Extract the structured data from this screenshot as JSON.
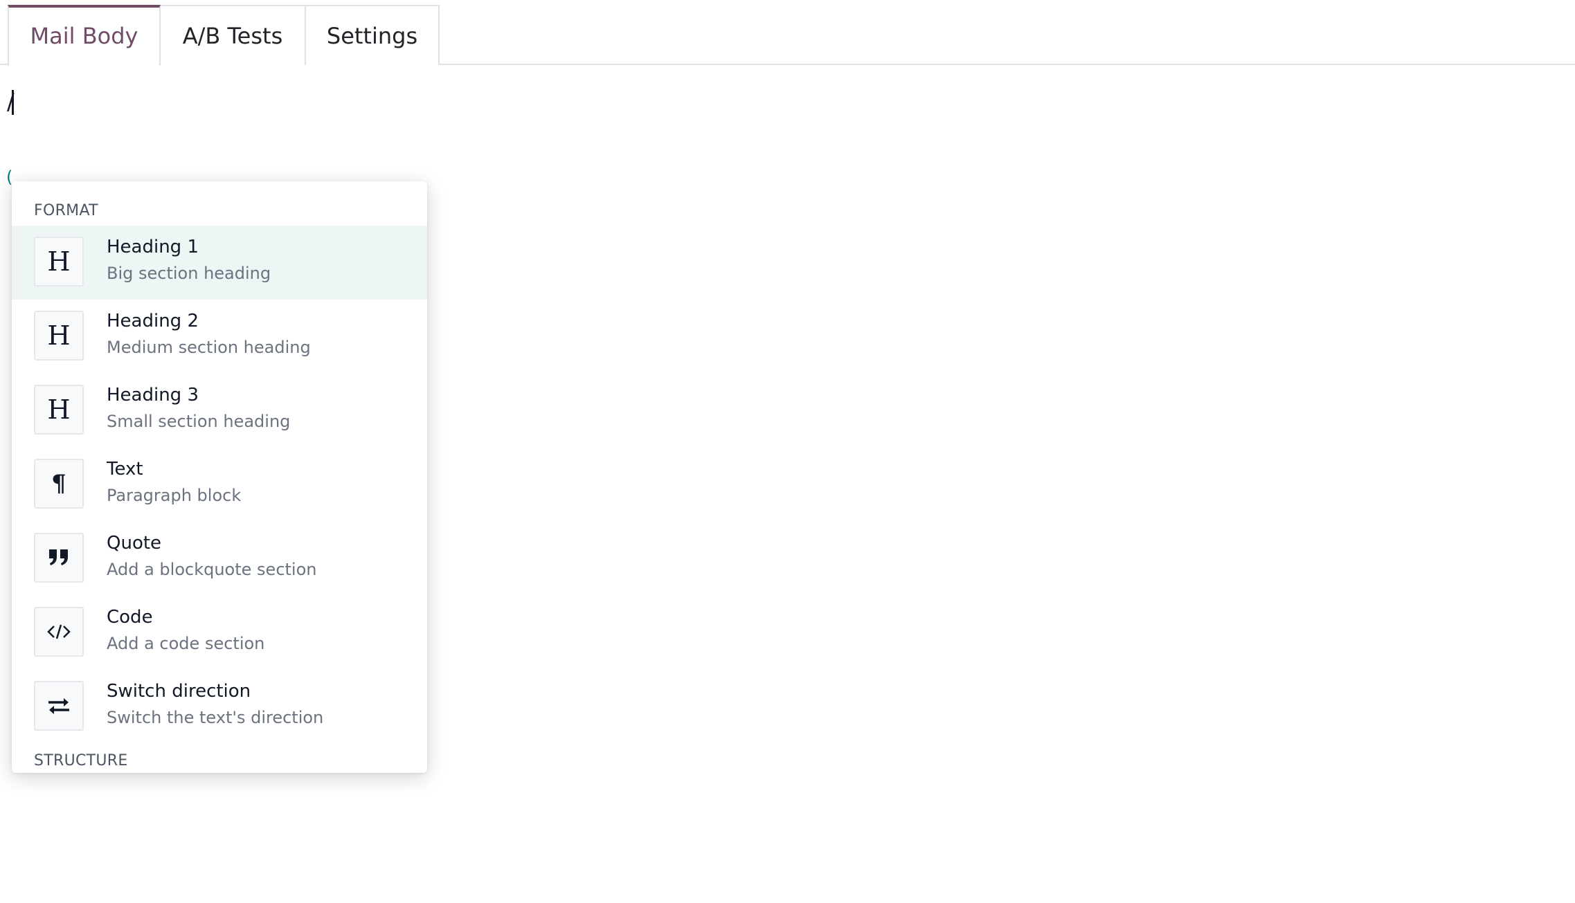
{
  "tabs": [
    {
      "label": "Mail Body",
      "active": true
    },
    {
      "label": "A/B Tests",
      "active": false
    },
    {
      "label": "Settings",
      "active": false
    }
  ],
  "editor": {
    "typed_text": "/"
  },
  "powerbox": {
    "groups": {
      "format": "FORMAT",
      "structure": "STRUCTURE"
    },
    "items": [
      {
        "title": "Heading 1",
        "description": "Big section heading",
        "icon": "heading-icon",
        "glyph": "H",
        "active": true
      },
      {
        "title": "Heading 2",
        "description": "Medium section heading",
        "icon": "heading-icon",
        "glyph": "H",
        "active": false
      },
      {
        "title": "Heading 3",
        "description": "Small section heading",
        "icon": "heading-icon",
        "glyph": "H",
        "active": false
      },
      {
        "title": "Text",
        "description": "Paragraph block",
        "icon": "paragraph-icon",
        "glyph": "¶",
        "active": false
      },
      {
        "title": "Quote",
        "description": "Add a blockquote section",
        "icon": "quote-icon",
        "active": false
      },
      {
        "title": "Code",
        "description": "Add a code section",
        "icon": "code-icon",
        "active": false
      },
      {
        "title": "Switch direction",
        "description": "Switch the text's direction",
        "icon": "exchange-icon",
        "active": false
      }
    ]
  },
  "colors": {
    "brand": "#714b67",
    "active_item_bg": "#edf6f5",
    "border": "#dee2e6",
    "muted_text": "#6b7280"
  }
}
